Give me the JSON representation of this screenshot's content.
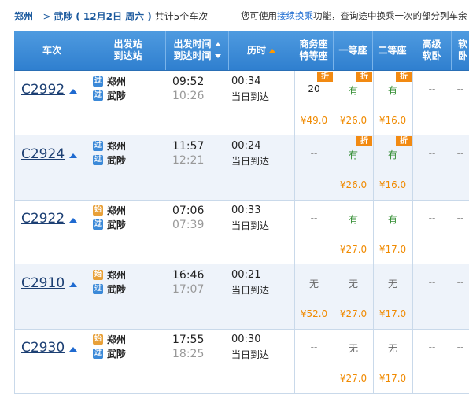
{
  "header": {
    "from": "郑州",
    "arrow": "-->",
    "to": "武陟",
    "date": "( 12月2日  周六 )",
    "count": "共计5个车次",
    "notice_prefix": "您可使用",
    "notice_link": "接续换乘",
    "notice_suffix": "功能，查询途中换乘一次的部分列车余"
  },
  "columns": {
    "train": "车次",
    "station_1": "出发站",
    "station_2": "到达站",
    "time_1": "出发时间",
    "time_2": "到达时间",
    "duration": "历时",
    "business_1": "商务座",
    "business_2": "特等座",
    "first": "一等座",
    "second": "二等座",
    "premium_1": "高级",
    "premium_2": "软卧",
    "soft": "软卧"
  },
  "colors": {
    "header_blue": "#3d8bd6",
    "price_orange": "#f08a00",
    "available_green": "#2e8b2e",
    "discount_orange": "#f28a12"
  },
  "trains": [
    {
      "code": "C2992",
      "from_badge": "过",
      "from": "郑州",
      "to_badge": "过",
      "to": "武陟",
      "dep": "09:52",
      "arr": "10:26",
      "duration": "00:34",
      "arrival_day": "当日到达",
      "business": "20",
      "first": "有",
      "second": "有",
      "premium": "--",
      "soft": "--",
      "discount_label": "折",
      "price_business": "¥49.0",
      "price_first": "¥26.0",
      "price_second": "¥16.0"
    },
    {
      "code": "C2924",
      "from_badge": "过",
      "from": "郑州",
      "to_badge": "过",
      "to": "武陟",
      "dep": "11:57",
      "arr": "12:21",
      "duration": "00:24",
      "arrival_day": "当日到达",
      "business": "--",
      "first": "有",
      "second": "有",
      "premium": "--",
      "soft": "--",
      "discount_label": "折",
      "price_business": "",
      "price_first": "¥26.0",
      "price_second": "¥16.0"
    },
    {
      "code": "C2922",
      "from_badge": "始",
      "from": "郑州",
      "to_badge": "过",
      "to": "武陟",
      "dep": "07:06",
      "arr": "07:39",
      "duration": "00:33",
      "arrival_day": "当日到达",
      "business": "--",
      "first": "有",
      "second": "有",
      "premium": "--",
      "soft": "--",
      "price_business": "",
      "price_first": "¥27.0",
      "price_second": "¥17.0"
    },
    {
      "code": "C2910",
      "from_badge": "始",
      "from": "郑州",
      "to_badge": "过",
      "to": "武陟",
      "dep": "16:46",
      "arr": "17:07",
      "duration": "00:21",
      "arrival_day": "当日到达",
      "business": "无",
      "first": "无",
      "second": "无",
      "premium": "--",
      "soft": "--",
      "price_business": "¥52.0",
      "price_first": "¥27.0",
      "price_second": "¥17.0"
    },
    {
      "code": "C2930",
      "from_badge": "始",
      "from": "郑州",
      "to_badge": "过",
      "to": "武陟",
      "dep": "17:55",
      "arr": "18:25",
      "duration": "00:30",
      "arrival_day": "当日到达",
      "business": "--",
      "first": "无",
      "second": "无",
      "premium": "--",
      "soft": "--",
      "price_business": "",
      "price_first": "¥27.0",
      "price_second": "¥17.0"
    }
  ]
}
